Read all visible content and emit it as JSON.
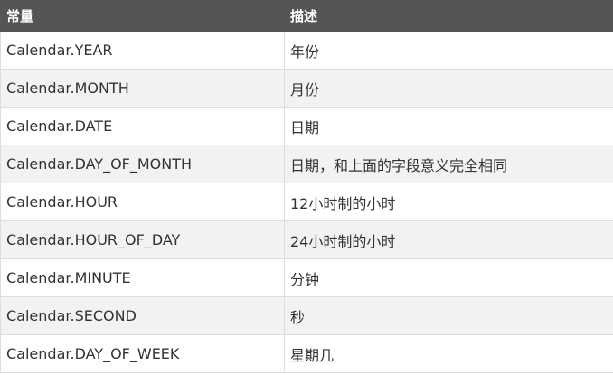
{
  "table": {
    "headers": [
      "常量",
      "描述"
    ],
    "rows": [
      [
        "Calendar.YEAR",
        "年份"
      ],
      [
        "Calendar.MONTH",
        "月份"
      ],
      [
        "Calendar.DATE",
        "日期"
      ],
      [
        "Calendar.DAY_OF_MONTH",
        "日期，和上面的字段意义完全相同"
      ],
      [
        "Calendar.HOUR",
        "12小时制的小时"
      ],
      [
        "Calendar.HOUR_OF_DAY",
        "24小时制的小时"
      ],
      [
        "Calendar.MINUTE",
        "分钟"
      ],
      [
        "Calendar.SECOND",
        "秒"
      ],
      [
        "Calendar.DAY_OF_WEEK",
        "星期几"
      ]
    ]
  },
  "colors": {
    "header_bg": "#555555",
    "header_text": "#ffffff",
    "row_alt_bg": "#f2f2f2",
    "border": "#dddddd"
  }
}
